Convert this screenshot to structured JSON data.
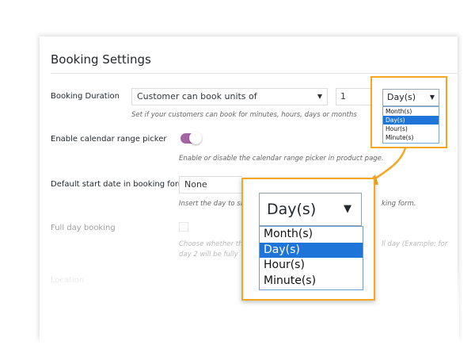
{
  "title": "Booking Settings",
  "colors": {
    "accent": "#f5a623",
    "toggle_on": "#a565a5",
    "selection": "#1e74d8"
  },
  "fields": {
    "booking_duration": {
      "label": "Booking Duration",
      "mode_value": "Customer can book units of",
      "units_value": "1",
      "unit_value": "Day(s)",
      "description": "Set if your customers can book for minutes, hours, days or months"
    },
    "calendar_range": {
      "label": "Enable calendar range picker",
      "enabled": true,
      "description": "Enable or disable the calendar range picker in product page."
    },
    "default_start": {
      "label": "Default start date in booking form",
      "value": "None",
      "description_left": "Insert the day to sh",
      "description_right": "king form."
    },
    "full_day": {
      "label": "Full day booking",
      "checked": false,
      "description_left": "Choose whether th",
      "description_right": "ll day (Example: for",
      "description_line2": "day 2 will be fully"
    },
    "location": {
      "label": "Location"
    }
  },
  "dropdown": {
    "selected": "Day(s)",
    "options": [
      "Month(s)",
      "Day(s)",
      "Hour(s)",
      "Minute(s)"
    ],
    "highlighted_index": 1
  }
}
